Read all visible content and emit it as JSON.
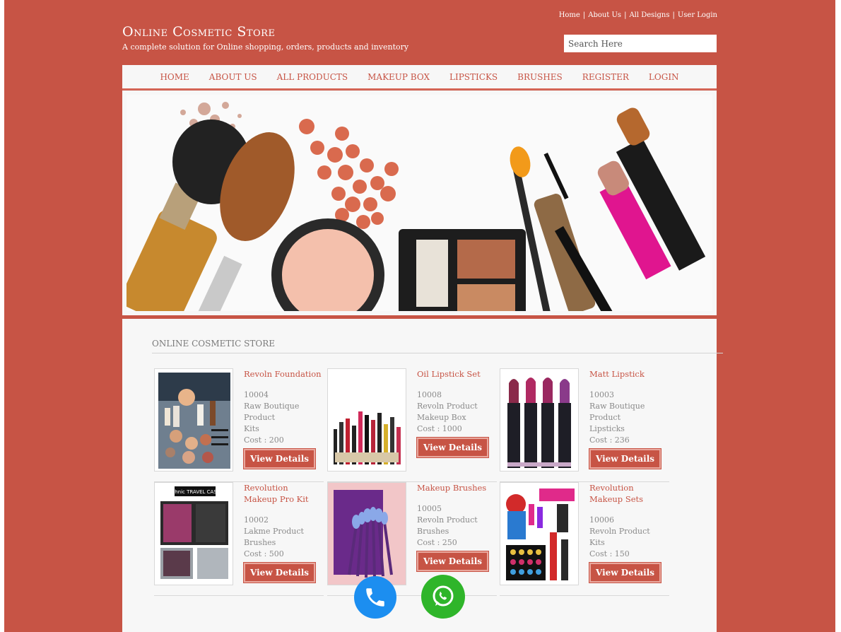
{
  "top_links": [
    "Home",
    "About Us",
    "All Designs",
    "User Login"
  ],
  "brand": {
    "title": "Online Cosmetic Store",
    "subtitle": "A complete solution for Online shopping, orders, products and inventory"
  },
  "search": {
    "placeholder": "Search Here"
  },
  "nav": [
    "HOME",
    "ABOUT US",
    "ALL PRODUCTS",
    "MAKEUP BOX",
    "LIPSTICKS",
    "BRUSHES",
    "REGISTER",
    "LOGIN"
  ],
  "section": {
    "title": "ONLINE COSMETIC STORE"
  },
  "products": [
    {
      "name": "Revoln Foundation",
      "code": "10004",
      "brand": "Raw Boutique Product",
      "category": "Kits",
      "cost": "Cost : 200",
      "button": "View Details",
      "thumb_icon": "foundation-kit-image"
    },
    {
      "name": "Oil Lipstick Set",
      "code": "10008",
      "brand": "Revoln Product",
      "category": "Makeup Box",
      "cost": "Cost : 1000",
      "button": "View Details",
      "thumb_icon": "lipstick-set-image"
    },
    {
      "name": "Matt Lipstick",
      "code": "10003",
      "brand": "Raw Boutique Product",
      "category": "Lipsticks",
      "cost": "Cost : 236",
      "button": "View Details",
      "thumb_icon": "matt-lipstick-image"
    },
    {
      "name": "Revolution Makeup Pro Kit",
      "code": "10002",
      "brand": "Lakme Product",
      "category": "Brushes",
      "cost": "Cost : 500",
      "button": "View Details",
      "thumb_icon": "makeup-case-image",
      "thumb_label": "technic TRAVEL CASES"
    },
    {
      "name": "Makeup Brushes",
      "code": "10005",
      "brand": "Revoln Product",
      "category": "Brushes",
      "cost": "Cost : 250",
      "button": "View Details",
      "thumb_icon": "brush-set-image"
    },
    {
      "name": "Revolution Makeup Sets",
      "code": "10006",
      "brand": "Revoln Product",
      "category": "Kits",
      "cost": "Cost : 150",
      "button": "View Details",
      "thumb_icon": "makeup-sets-image"
    }
  ],
  "floating": {
    "phone_icon": "phone-icon",
    "whatsapp_icon": "whatsapp-icon"
  },
  "colors": {
    "brand": "#c75445",
    "panel": "#f7f7f7",
    "phone": "#1c8ef0",
    "whatsapp": "#2fb52a"
  }
}
